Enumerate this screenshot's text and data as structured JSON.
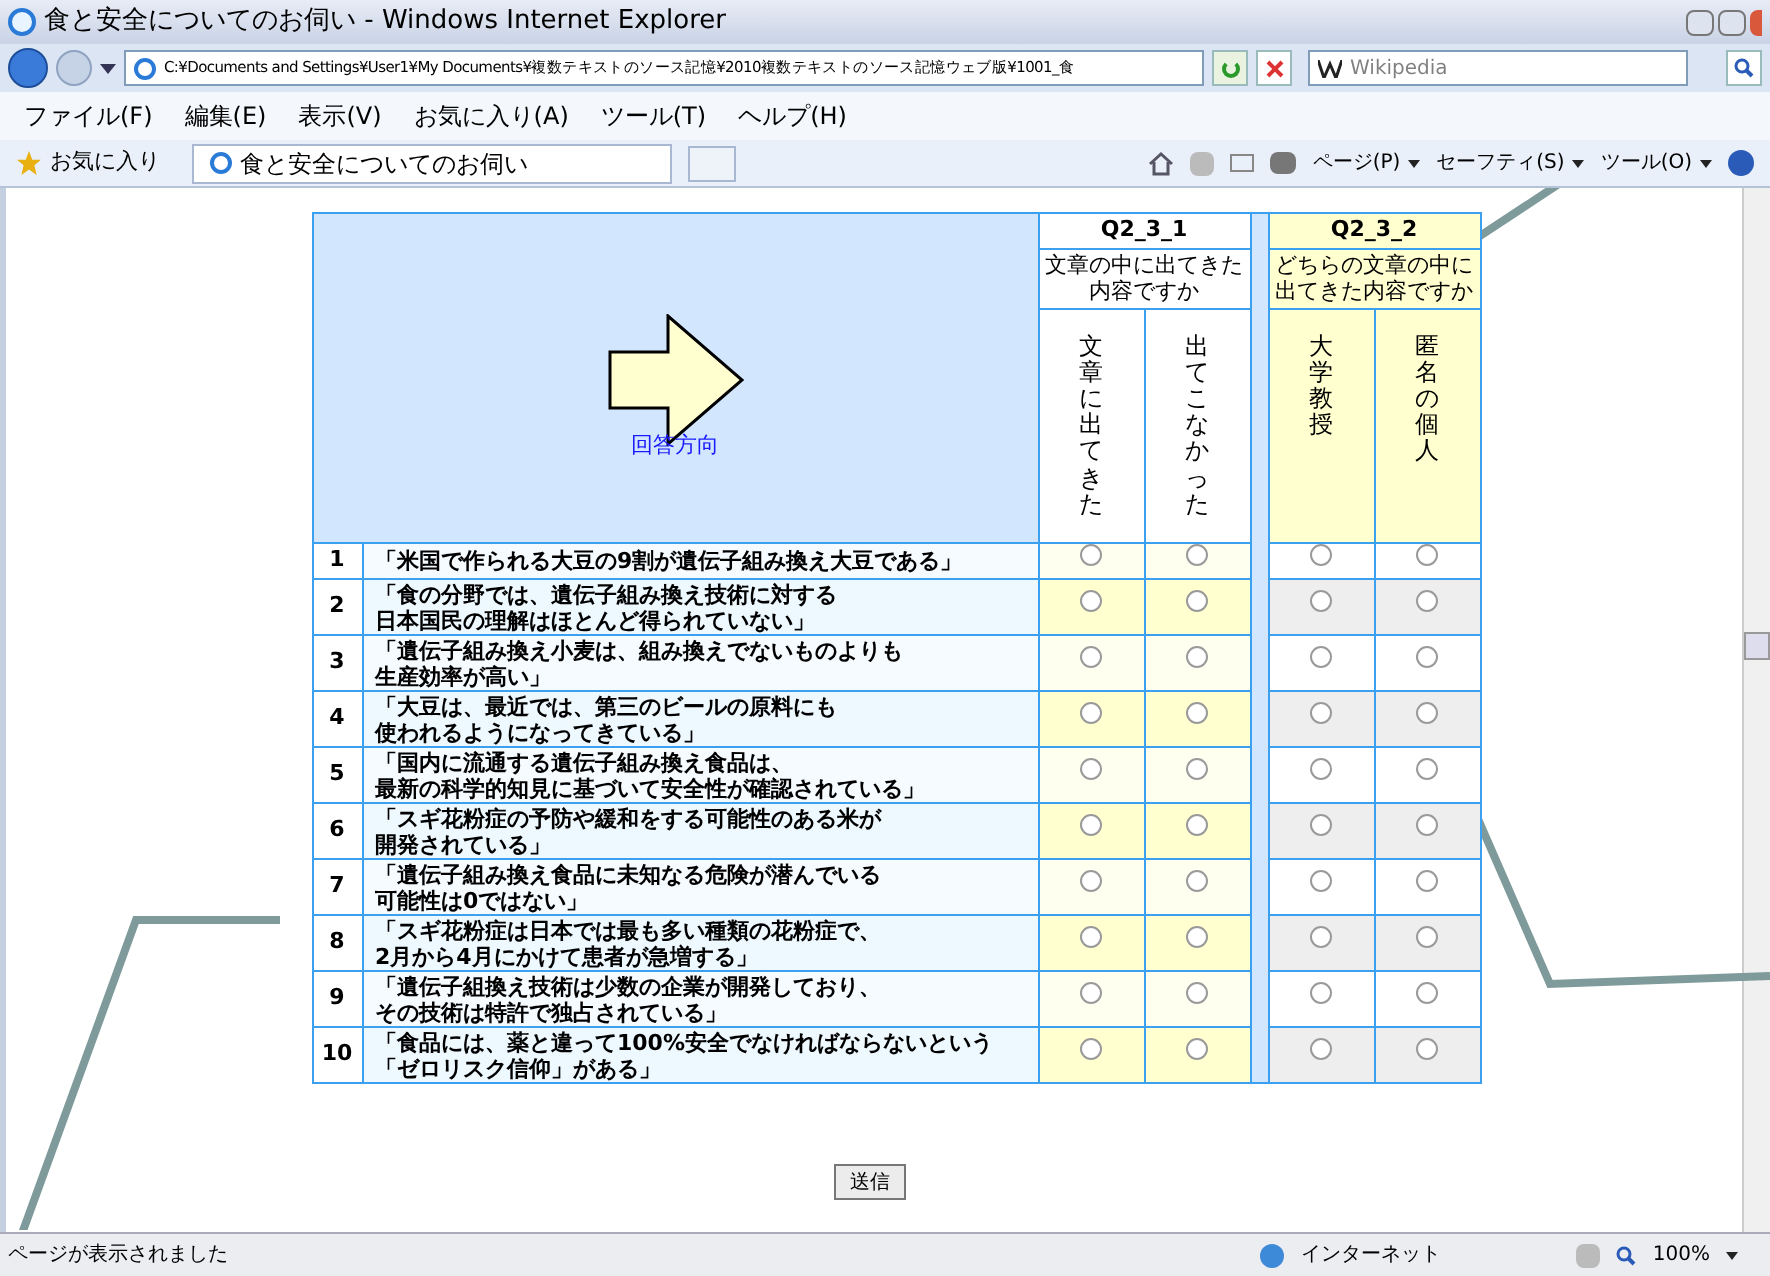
{
  "window": {
    "title": "食と安全についてのお伺い - Windows Internet Explorer"
  },
  "address": "C:¥Documents and Settings¥User1¥My Documents¥複数テキストのソース記憶¥2010複数テキストのソース記憶ウェブ版¥1001_食",
  "search": {
    "placeholder": "Wikipedia"
  },
  "menu": [
    "ファイル(F)",
    "編集(E)",
    "表示(V)",
    "お気に入り(A)",
    "ツール(T)",
    "ヘルプ(H)"
  ],
  "favorites": "お気に入り",
  "tab": {
    "title": "食と安全についてのお伺い",
    "selected": true
  },
  "toolbar": [
    "ページ(P)",
    "セーフティ(S)",
    "ツール(O)"
  ],
  "table": {
    "direction_label": "回答方向",
    "groups": [
      {
        "code": "Q2_3_1",
        "question": "文章の中に出てきた内容ですか",
        "options": [
          "文章に出てきた",
          "出てこなかった"
        ]
      },
      {
        "code": "Q2_3_2",
        "question": "どちらの文章の中に出てきた内容ですか",
        "options": [
          "大学教授",
          "匿名の個人"
        ]
      }
    ],
    "rows": [
      {
        "number": "1",
        "text": [
          "「米国で作られる大豆の9割が遺伝子組み換え大豆である」"
        ],
        "choices": [
          {
            "selected": false
          },
          {
            "selected": false
          },
          {
            "selected": false
          },
          {
            "selected": false
          }
        ]
      },
      {
        "number": "2",
        "text": [
          "「食の分野では、遺伝子組み換え技術に対する",
          "日本国民の理解はほとんど得られていない」"
        ],
        "choices": [
          {
            "selected": false
          },
          {
            "selected": false
          },
          {
            "selected": false
          },
          {
            "selected": false
          }
        ]
      },
      {
        "number": "3",
        "text": [
          "「遺伝子組み換え小麦は、組み換えでないものよりも",
          "生産効率が高い」"
        ],
        "choices": [
          {
            "selected": false
          },
          {
            "selected": false
          },
          {
            "selected": false
          },
          {
            "selected": false
          }
        ]
      },
      {
        "number": "4",
        "text": [
          "「大豆は、最近では、第三のビールの原料にも",
          "使われるようになってきている」"
        ],
        "choices": [
          {
            "selected": false
          },
          {
            "selected": false
          },
          {
            "selected": false
          },
          {
            "selected": false
          }
        ]
      },
      {
        "number": "5",
        "text": [
          "「国内に流通する遺伝子組み換え食品は、",
          "最新の科学的知見に基づいて安全性が確認されている」"
        ],
        "choices": [
          {
            "selected": false
          },
          {
            "selected": false
          },
          {
            "selected": false
          },
          {
            "selected": false
          }
        ]
      },
      {
        "number": "6",
        "text": [
          "「スギ花粉症の予防や緩和をする可能性のある米が",
          "開発されている」"
        ],
        "choices": [
          {
            "selected": false
          },
          {
            "selected": false
          },
          {
            "selected": false
          },
          {
            "selected": false
          }
        ]
      },
      {
        "number": "7",
        "text": [
          "「遺伝子組み換え食品に未知なる危険が潜んでいる",
          "可能性は0ではない」"
        ],
        "choices": [
          {
            "selected": false
          },
          {
            "selected": false
          },
          {
            "selected": false
          },
          {
            "selected": false
          }
        ]
      },
      {
        "number": "8",
        "text": [
          "「スギ花粉症は日本では最も多い種類の花粉症で、",
          "2月から4月にかけて患者が急増する」"
        ],
        "choices": [
          {
            "selected": false
          },
          {
            "selected": false
          },
          {
            "selected": false
          },
          {
            "selected": false
          }
        ]
      },
      {
        "number": "9",
        "text": [
          "「遺伝子組換え技術は少数の企業が開発しており、",
          "その技術は特許で独占されている」"
        ],
        "choices": [
          {
            "selected": false
          },
          {
            "selected": false
          },
          {
            "selected": false
          },
          {
            "selected": false
          }
        ]
      },
      {
        "number": "10",
        "text": [
          "「食品には、薬と違って100%安全でなければならないという",
          "「ゼロリスク信仰」がある」"
        ],
        "choices": [
          {
            "selected": false
          },
          {
            "selected": false
          },
          {
            "selected": false
          },
          {
            "selected": false
          }
        ]
      }
    ]
  },
  "submit": "送信",
  "status_bar": {
    "text": "ページが表示されました",
    "zone": "インターネット",
    "zoom": "100%"
  }
}
